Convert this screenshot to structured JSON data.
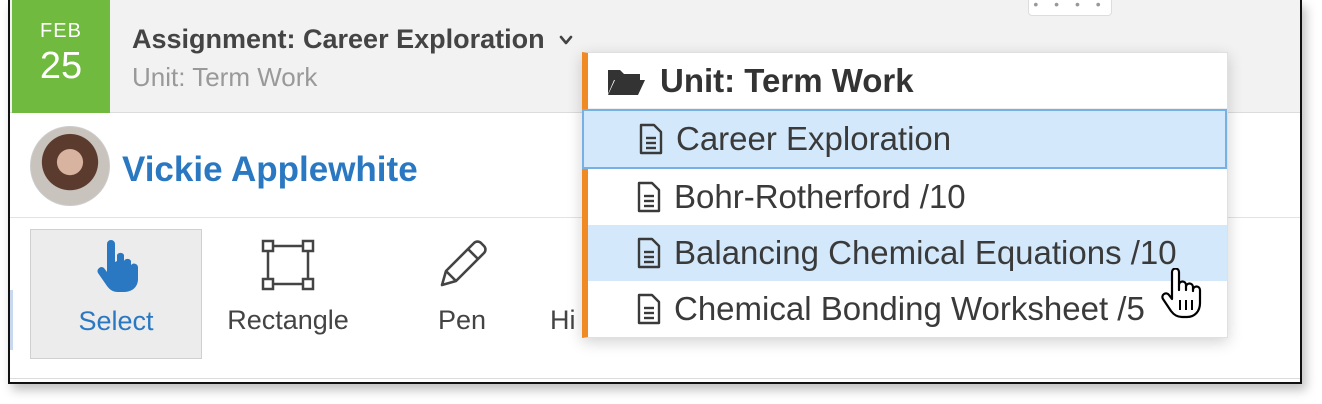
{
  "header": {
    "date_month": "FEB",
    "date_day": "25",
    "assignment_title": "Assignment: Career Exploration",
    "unit_subtitle": "Unit: Term Work",
    "grip_dots": "• • • •"
  },
  "student": {
    "name": "Vickie Applewhite"
  },
  "toolbar": {
    "tools": [
      {
        "label": "Select",
        "icon": "pointer-hand-icon",
        "active": true
      },
      {
        "label": "Rectangle",
        "icon": "rectangle-icon",
        "active": false
      },
      {
        "label": "Pen",
        "icon": "pen-icon",
        "active": false
      },
      {
        "label": "Hi",
        "icon": "",
        "active": false
      }
    ]
  },
  "dropdown": {
    "header": "Unit: Term Work",
    "items": [
      {
        "label": "Career Exploration",
        "state": "selected"
      },
      {
        "label": "Bohr-Rotherford /10",
        "state": "normal"
      },
      {
        "label": "Balancing Chemical Equations /10",
        "state": "hover"
      },
      {
        "label": "Chemical Bonding Worksheet /5",
        "state": "normal"
      }
    ]
  },
  "colors": {
    "date_badge": "#6fba3f",
    "accent_blue": "#2a78c2",
    "dropdown_accent": "#f08a24",
    "highlight": "#d3e8fb"
  }
}
